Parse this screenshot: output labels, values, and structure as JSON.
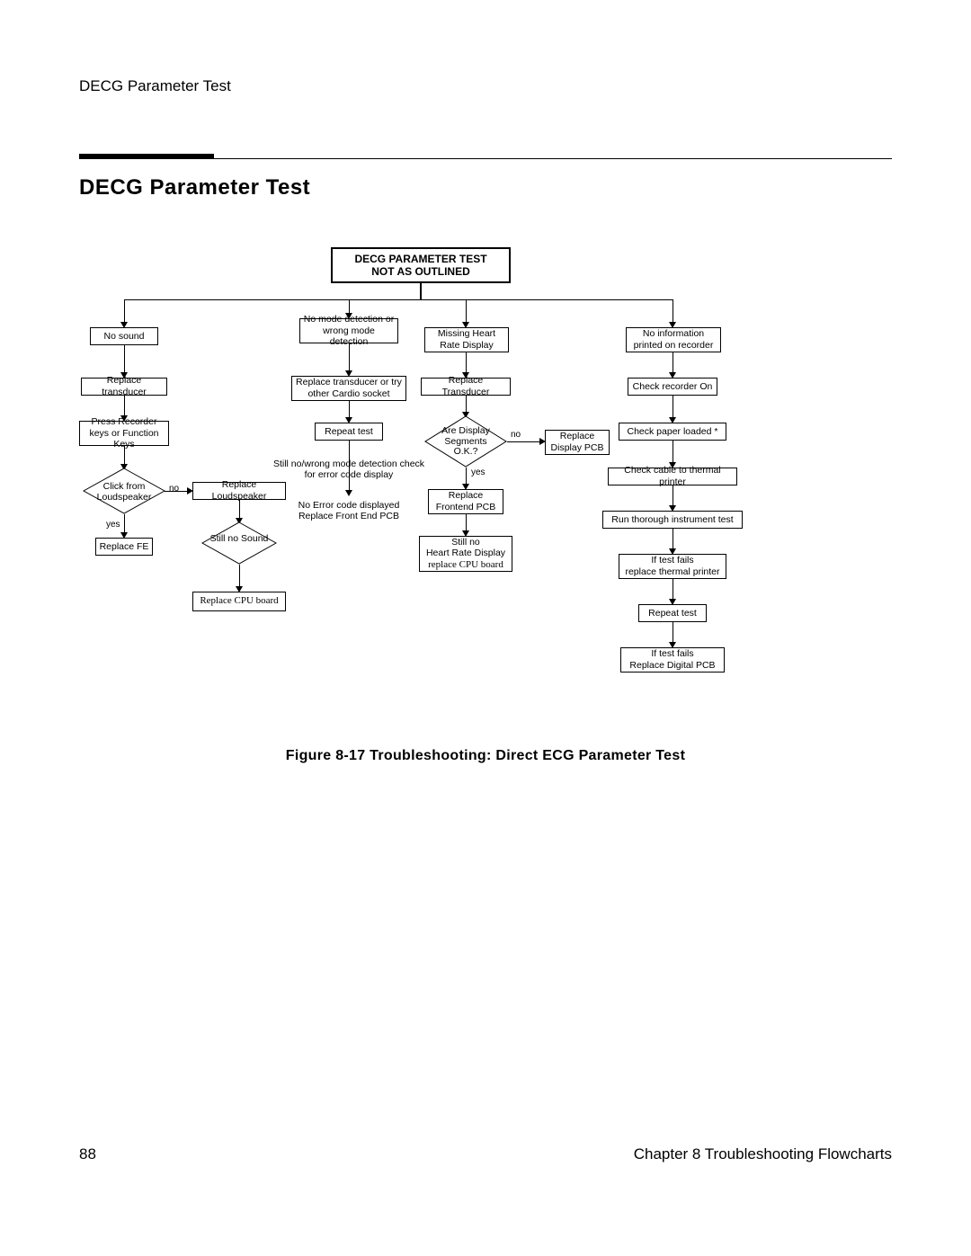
{
  "header": {
    "running": "DECG Parameter Test"
  },
  "title": "DECG Parameter Test",
  "caption": "Figure 8-17  Troubleshooting: Direct ECG Parameter Test",
  "footer": {
    "page_number": "88",
    "chapter": "Chapter 8   Troubleshooting Flowcharts"
  },
  "flow": {
    "root": {
      "line1": "DECG PARAMETER TEST",
      "line2": "NOT AS OUTLINED"
    },
    "col1": {
      "n1": "No sound",
      "n2": "Replace transducer",
      "n3": "Press Recorder keys or Function Keys",
      "d1": "Click from Loudspeaker",
      "d1_no": "no",
      "d1_yes": "yes",
      "n4": "Replace Loudspeaker",
      "d2": "Still no Sound",
      "n5": "Replace FE",
      "n6": "Replace CPU board"
    },
    "col2": {
      "n1": "No mode detection or wrong mode detection",
      "n2": "Replace transducer or try other Cardio socket",
      "n3": "Repeat test",
      "note1": "Still no/wrong mode detection check for error code display",
      "note2a": "No Error code displayed",
      "note2b": "Replace Front End PCB"
    },
    "col3": {
      "n1": "Missing Heart Rate Display",
      "n2": "Replace Transducer",
      "d1a": "Are Display",
      "d1b": "Segments",
      "d1c": "O.K.?",
      "d1_no": "no",
      "d1_yes": "yes",
      "n3": "Replace Display PCB",
      "n4": "Replace Frontend PCB",
      "n5a": "Still no",
      "n5b": "Heart Rate Display",
      "n5c": "replace CPU board"
    },
    "col4": {
      "n1": "No information printed on recorder",
      "n2": "Check recorder On",
      "n3": "Check paper loaded *",
      "n4": "Check cable to thermal printer",
      "n5": "Run thorough instrument test",
      "n6a": "If test fails",
      "n6b": "replace thermal printer",
      "n7": "Repeat test",
      "n8a": "If test fails",
      "n8b": "Replace Digital PCB"
    }
  }
}
